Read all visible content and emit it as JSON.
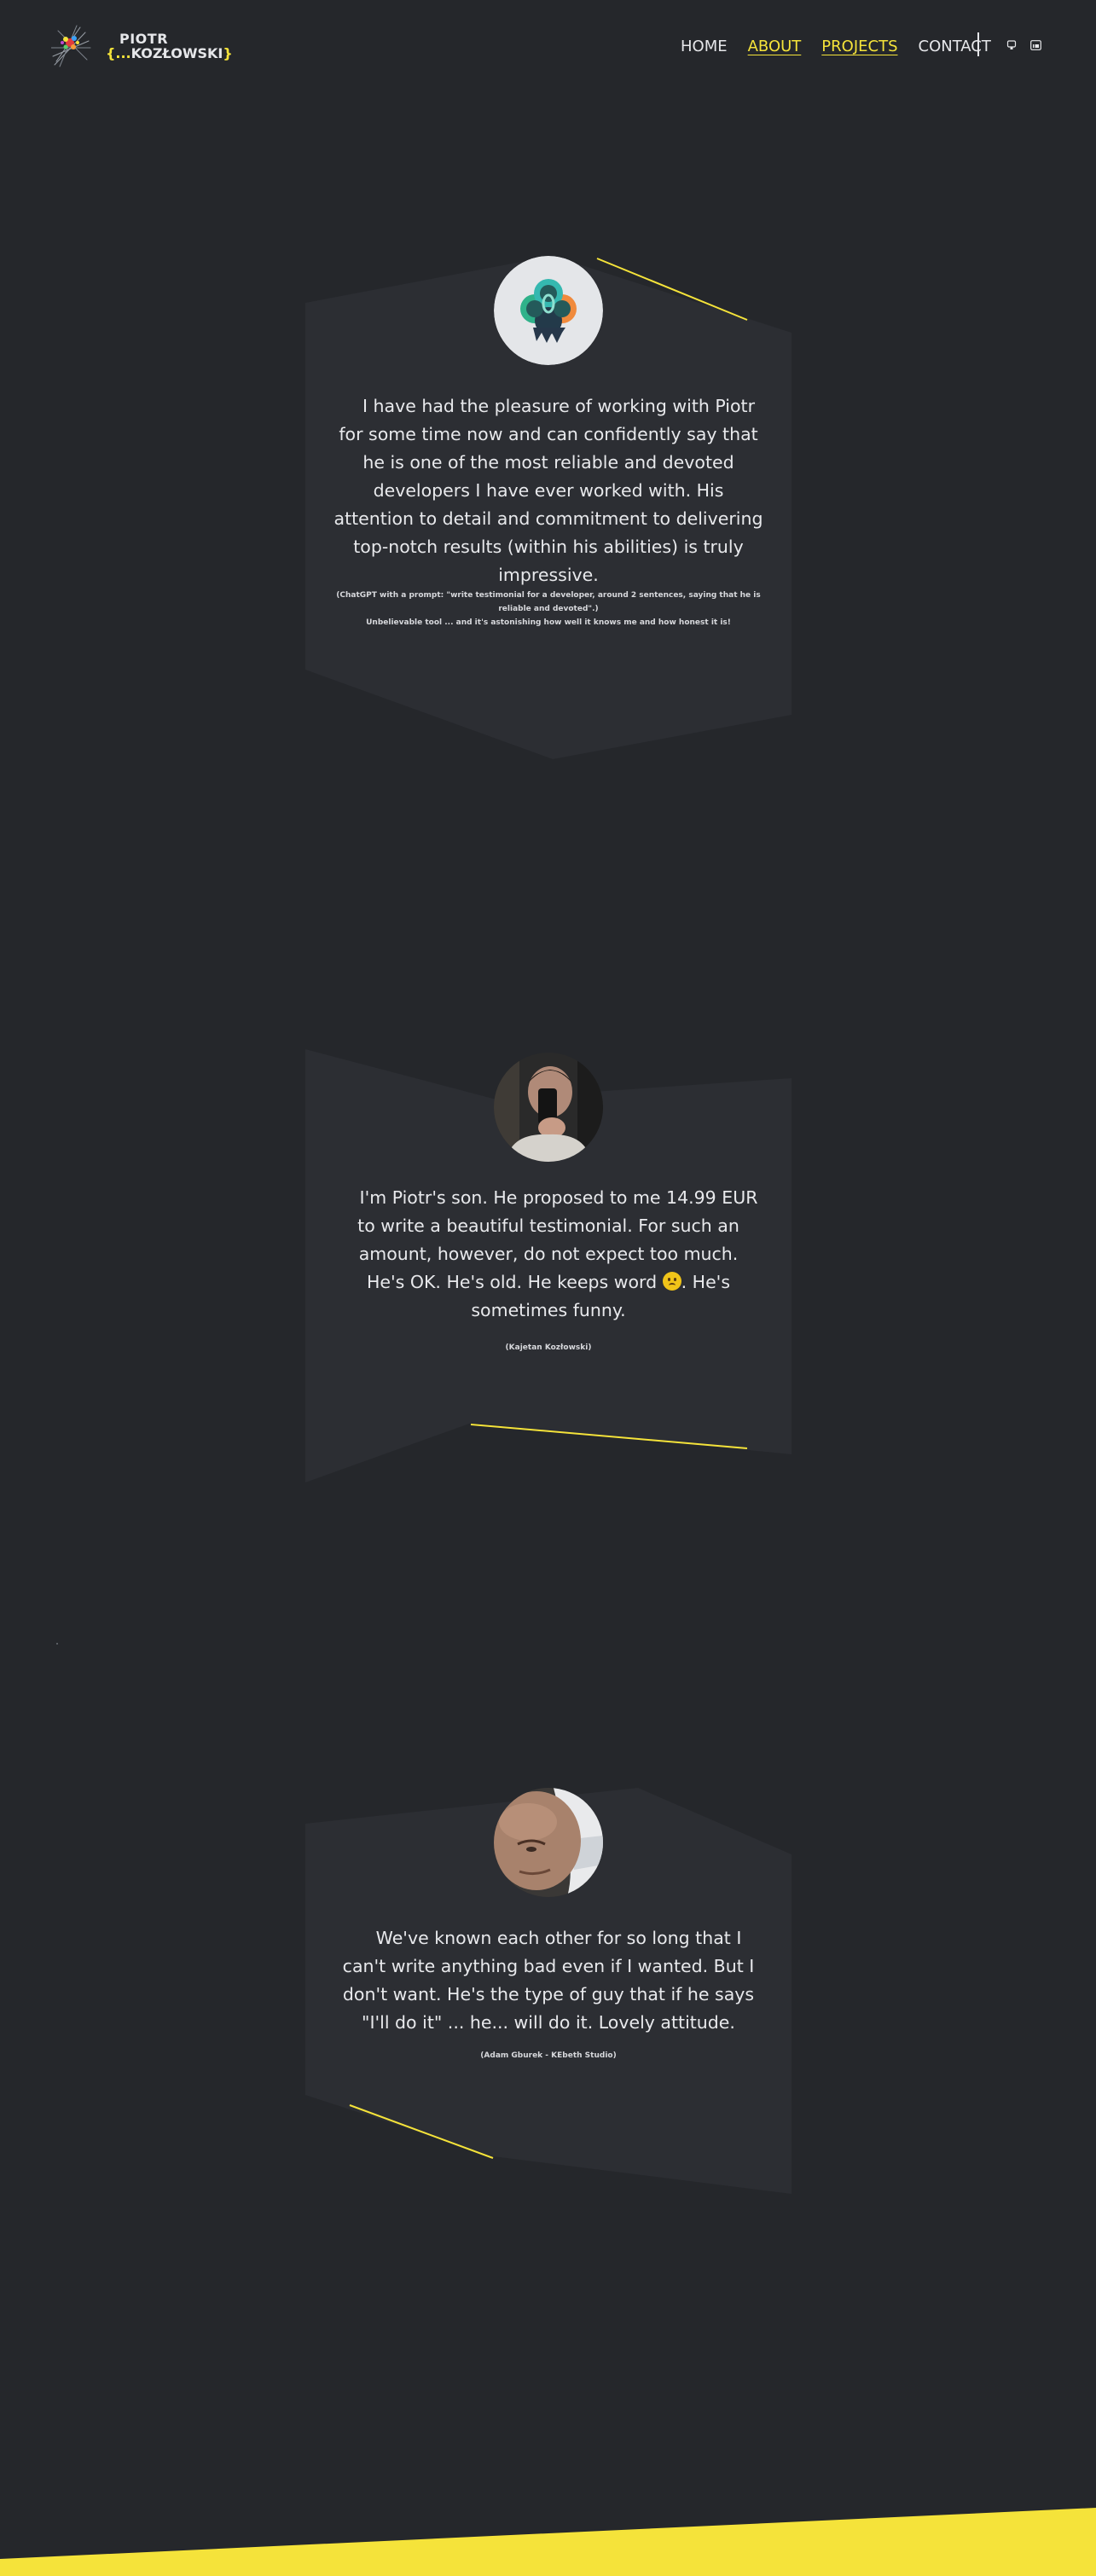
{
  "header": {
    "logo": {
      "line1": "PIOTR",
      "line2_open": "{...",
      "line2_name": "KOZŁOWSKI",
      "line2_close": "}"
    },
    "nav": [
      {
        "label": "HOME"
      },
      {
        "label": "ABOUT"
      },
      {
        "label": "PROJECTS"
      },
      {
        "label": "CONTACT"
      }
    ],
    "icons": [
      "github-icon",
      "linkedin-icon"
    ]
  },
  "testimonials": [
    {
      "avatar": "chatgpt-logo",
      "quote": "I have had the pleasure of working with Piotr for some time now and can confidently say that he is one of the most reliable and devoted developers I have ever worked with. His attention to detail and commitment to delivering top-notch results (within his abilities) is truly impressive.",
      "author_line1": "(ChatGPT with a prompt: \"write testimonial for a developer, around 2 sentences, saying that he is reliable and devoted\".)",
      "author_line2": "Unbelievable tool ... and it's astonishing how well it knows me and how honest it is!"
    },
    {
      "avatar": "young-man-photo",
      "quote_part1": "I'm Piotr's son. He proposed to me 14.99 EUR to write a beautiful testimonial. For such an amount, however, do not expect too much.",
      "quote_part2": "He's OK. He's old. He keeps word",
      "quote_part3": ". He's sometimes funny.",
      "author": "(Kajetan Kozłowski)"
    },
    {
      "avatar": "bald-man-photo",
      "quote": "We've known each other for so long that I can't write anything bad even if I wanted. But I don't want. He's the type of guy that if he says \"I'll do it\" ... he... will do it. Lovely attitude.",
      "author": "(Adam Gburek - KEbeth Studio)"
    }
  ],
  "colors": {
    "background": "#25272b",
    "card": "#2c2e33",
    "accent": "#f5e33a",
    "text": "#e6e7ea"
  }
}
